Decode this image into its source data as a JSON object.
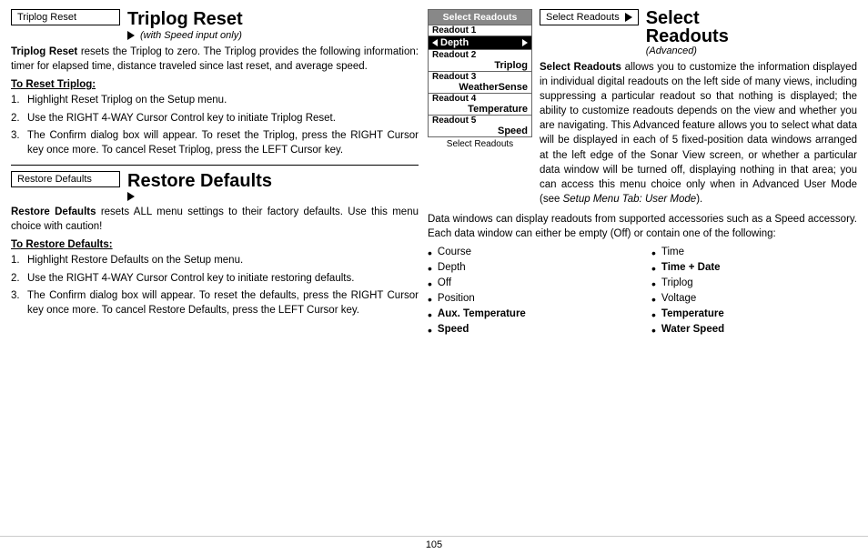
{
  "left": {
    "triplog_reset": {
      "menu_label": "Triplog Reset",
      "title": "Triplog Reset",
      "subtitle": "(with Speed input only)",
      "arrow": "▶",
      "intro": "Triplog Reset resets the Triplog to zero. The Triplog provides the following information: timer for elapsed time, distance traveled since last reset, and average speed.",
      "intro_bold": "Triplog Reset",
      "to_reset_heading": "To Reset Triplog:",
      "steps": [
        "Highlight Reset Triplog on the Setup menu.",
        "Use the RIGHT 4-WAY Cursor Control key to initiate Triplog Reset.",
        "The Confirm dialog box will appear. To reset the Triplog, press the RIGHT Cursor key once more. To cancel Reset Triplog, press the LEFT Cursor key."
      ]
    },
    "restore_defaults": {
      "menu_label": "Restore Defaults",
      "title": "Restore Defaults",
      "arrow": "▶",
      "intro_bold": "Restore Defaults",
      "intro": "Restore Defaults resets ALL menu settings to their factory defaults. Use this menu choice with caution!",
      "to_restore_heading": "To Restore Defaults:",
      "steps": [
        "Highlight Restore Defaults on the Setup menu.",
        "Use the RIGHT 4-WAY Cursor Control key to initiate restoring defaults.",
        "The Confirm dialog box will appear. To reset the defaults, press the RIGHT Cursor key once more. To cancel Restore Defaults, press the LEFT Cursor key."
      ]
    }
  },
  "right": {
    "panel_header": "Select Readouts",
    "readouts": [
      {
        "label": "Readout 1",
        "value": "",
        "selected": false
      },
      {
        "label": "Depth",
        "value": "",
        "selected": true,
        "is_depth": true
      },
      {
        "label": "Readout 2",
        "value": "",
        "selected": false
      },
      {
        "label": "Triplog",
        "value": "",
        "selected": false
      },
      {
        "label": "Readout 3",
        "value": "",
        "selected": false
      },
      {
        "label": "WeatherSense",
        "value": "",
        "selected": false
      },
      {
        "label": "Readout 4",
        "value": "",
        "selected": false
      },
      {
        "label": "Temperature",
        "value": "",
        "selected": false
      },
      {
        "label": "Readout 5",
        "value": "",
        "selected": false
      },
      {
        "label": "Speed",
        "value": "",
        "selected": false
      }
    ],
    "panel_caption": "Select Readouts",
    "menu_title_box": "Select Readouts",
    "section_title": "Select\nReadouts",
    "section_title_line1": "Select",
    "section_title_line2": "Readouts",
    "section_advanced": "(Advanced)",
    "description": "Select Readouts allows you to customize the information displayed in individual digital readouts on the left side of many views, including suppressing a particular readout so that nothing is displayed; the ability to customize readouts depends on the view and whether you are navigating. This Advanced feature allows you to select what data will be displayed in each of 5 fixed-position data windows arranged at the left edge of the Sonar View screen, or whether a particular data window will be turned off, displaying nothing in that area; you can access this menu choice only when in Advanced User Mode (see Setup Menu Tab: User Mode.).",
    "description_bold": "Select Readouts",
    "description_italic": "Setup Menu Tab: User Mode",
    "data_windows_intro": "Data windows can display readouts from supported accessories such as a Speed accessory. Each data window can either be empty (Off) or contain one of the following:",
    "bullet_left": [
      "Course",
      "Depth",
      "Off",
      "Position",
      "Aux. Temperature",
      "Speed"
    ],
    "bullet_right": [
      "Time",
      "Time + Date",
      "Triplog",
      "Voltage",
      "Temperature",
      "Water Speed"
    ]
  },
  "footer": {
    "page_number": "105"
  }
}
